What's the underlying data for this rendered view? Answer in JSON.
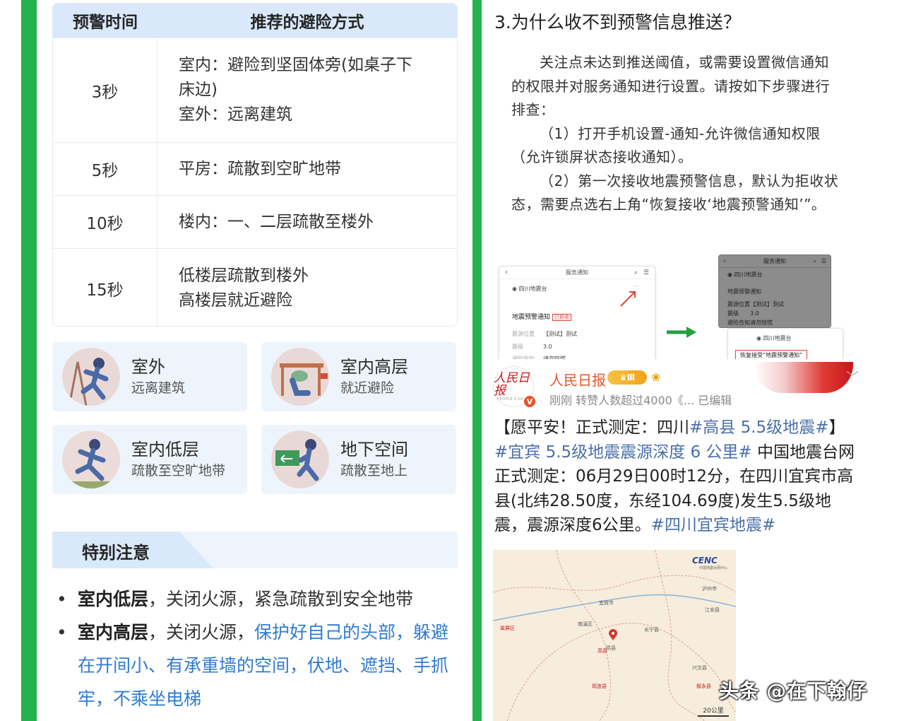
{
  "left": {
    "table": {
      "header": {
        "time": "预警时间",
        "method": "推荐的避险方式"
      },
      "rows": [
        {
          "time": "3秒",
          "lines": [
            "室内：避险到坚固体旁(如桌子下",
            "床边)",
            "室外：远离建筑"
          ]
        },
        {
          "time": "5秒",
          "lines": [
            "平房：疏散到空旷地带"
          ]
        },
        {
          "time": "10秒",
          "lines": [
            "楼内：一、二层疏散至楼外"
          ]
        },
        {
          "time": "15秒",
          "lines": [
            "低楼层疏散到楼外",
            "高楼层就近避险"
          ]
        }
      ]
    },
    "cards": [
      {
        "title": "室外",
        "subtitle": "远离建筑",
        "icon": "running-person-outdoor-icon"
      },
      {
        "title": "室内高层",
        "subtitle": "就近避险",
        "icon": "person-sheltering-icon"
      },
      {
        "title": "室内低层",
        "subtitle": "疏散至空旷地带",
        "icon": "running-person-icon"
      },
      {
        "title": "地下空间",
        "subtitle": "疏散至地上",
        "icon": "exit-sign-person-icon"
      }
    ],
    "notice": {
      "title": "特别注意",
      "items": [
        {
          "bold": "室内低层",
          "text": "，关闭火源，紧急疏散到安全地带",
          "blue": ""
        },
        {
          "bold": "室内高层",
          "text": "，关闭火源，",
          "blue": "保护好自己的头部，躲避在开间小、有承重墙的空间，伏地、遮挡、手抓牢，不乘坐电梯"
        }
      ]
    }
  },
  "right": {
    "question": "3.为什么收不到预警信息推送？",
    "answer": [
      "关注点未达到推送阈值，或需要设置微信通知的权限并对服务通知进行设置。请按如下步骤进行排查：",
      "（1）打开手机设置-通知-允许微信通知权限（允许锁屏状态接收通知）。",
      "（2）第一次接收地震预警信息，默认为拒收状态，需要点选右上角“恢复接收‘地震预警通知’”。"
    ],
    "screenshot1": {
      "header": "服务通知",
      "sender": "四川地震台",
      "notice_label": "地震预警通知",
      "status": "已拒收",
      "rows": [
        {
          "k": "震源位置",
          "v": "【测试】测试"
        },
        {
          "k": "震级",
          "v": "3.0"
        },
        {
          "k": "避险告知",
          "v": "请勿惊慌"
        }
      ]
    },
    "screenshot2": {
      "header": "服务通知",
      "sender": "四川地震台",
      "notice_label": "地震预警通知",
      "rows": [
        {
          "k": "震源位置",
          "v": "【测试】测试"
        },
        {
          "k": "震级",
          "v": "3.0"
        },
        {
          "k": "避险告知",
          "v": "请勿惊慌"
        }
      ]
    },
    "screenshot3": {
      "sender": "四川地震台",
      "button": "恢复接受“地震预警通知”"
    },
    "post": {
      "account": "人民日报",
      "logo_text": "人民日报",
      "logo_sub": "PEOPLE'S DAILY",
      "verified": "V",
      "level": "Ⅲ",
      "meta": "刚刚 转赞人数超过4000《... 已编辑",
      "text_parts": [
        {
          "t": "【愿平安！正式测定：四川",
          "tag": false
        },
        {
          "t": "#高县 5.5级地震#",
          "tag": true
        },
        {
          "t": "】",
          "tag": false
        },
        {
          "t": "#宜宾 5.5级地震震源深度 6 公里#",
          "tag": true
        },
        {
          "t": " 中国地震台网正式测定：06月29日00时12分，在四川宜宾市高县(北纬28.50度，东经104.69度)发生5.5级地震，震源深度6公里。",
          "tag": false
        },
        {
          "t": "#四川宜宾地震#",
          "tag": true
        }
      ]
    },
    "map": {
      "brand": "CENC",
      "brand_sub": "中国地震台网中心",
      "scale": "20公里",
      "labels": [
        "宜宾市",
        "高县",
        "珙县",
        "长宁县",
        "兴文县",
        "江安县",
        "筠连县",
        "南溪区",
        "翠屏区",
        "叙永县",
        "泸州市"
      ]
    },
    "watermark": "头条 @在下翰仔"
  }
}
